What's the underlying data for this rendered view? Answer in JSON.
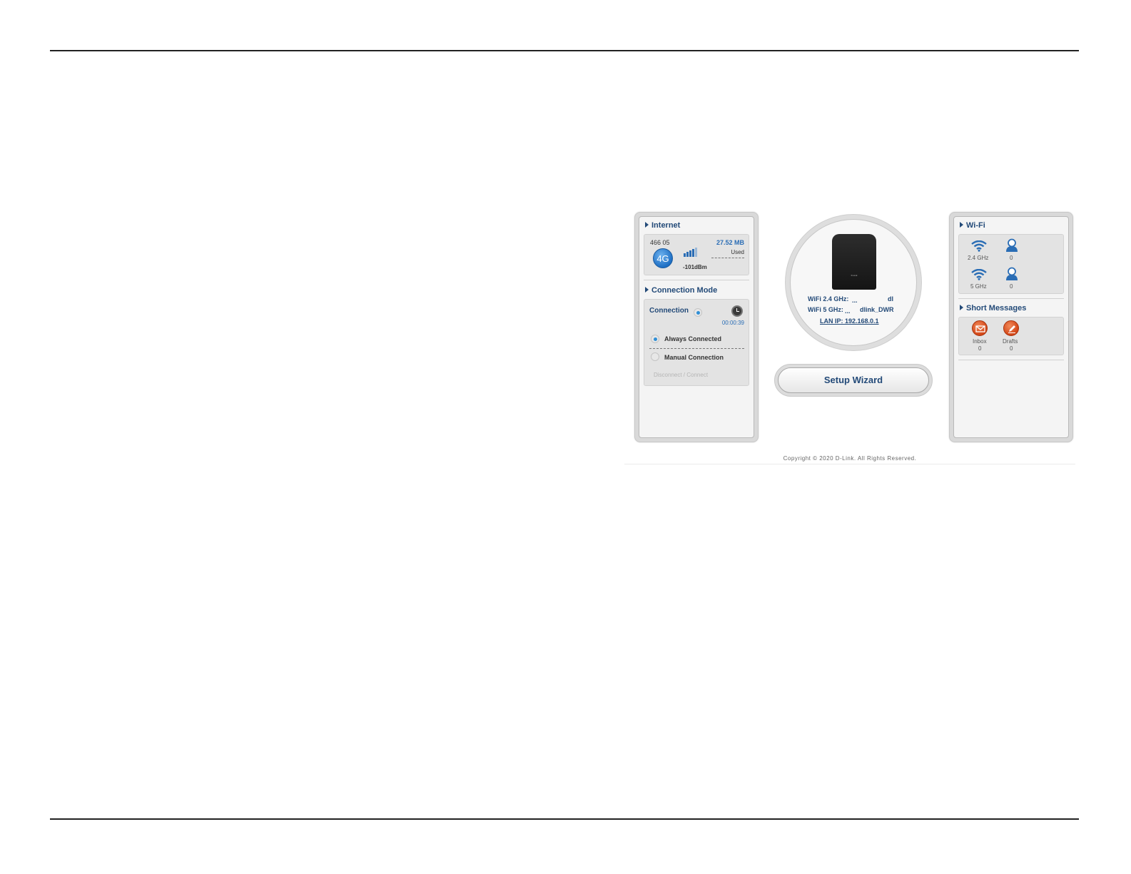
{
  "internet": {
    "title": "Internet",
    "operator": "466 05",
    "network_type": "4G",
    "data_used": "27.52 MB",
    "used_label": "Used",
    "signal": "-101dBm"
  },
  "connection_mode": {
    "title": "Connection Mode",
    "connection_label": "Connection",
    "timer": "00:00:39",
    "always_connected": "Always Connected",
    "manual_connection": "Manual Connection",
    "disconnect_connect": "Disconnect / Connect"
  },
  "device": {
    "logo": "D-Link",
    "wifi24_label": "WiFi 2.4 GHz:",
    "wifi24_ellipsis": "...",
    "wifi24_value": "dl",
    "wifi5_label": "WiFi 5 GHz:",
    "wifi5_ellipsis": "...",
    "wifi5_value": "dlink_DWR",
    "lan_ip": "LAN IP: 192.168.0.1"
  },
  "setup_wizard": {
    "label": "Setup Wizard"
  },
  "wifi": {
    "title": "Wi-Fi",
    "band24_label": "2.4 GHz",
    "band24_clients": "0",
    "band5_label": "5 GHz",
    "band5_clients": "0"
  },
  "sms": {
    "title": "Short Messages",
    "inbox_label": "Inbox",
    "inbox_count": "0",
    "drafts_label": "Drafts",
    "drafts_count": "0"
  },
  "footer": {
    "copyright": "Copyright © 2020 D-Link. All Rights Reserved."
  },
  "colors": {
    "accent": "#234a78",
    "link_blue": "#2a6db5",
    "sms_orange": "#d24516"
  },
  "icons": {
    "section_arrow": "triangle-right-icon",
    "network": "4g-badge-icon",
    "signal": "signal-bars-icon",
    "timer": "clock-icon",
    "wifi": "wifi-icon",
    "clients": "user-icon",
    "inbox": "envelope-icon",
    "drafts": "pencil-icon"
  }
}
